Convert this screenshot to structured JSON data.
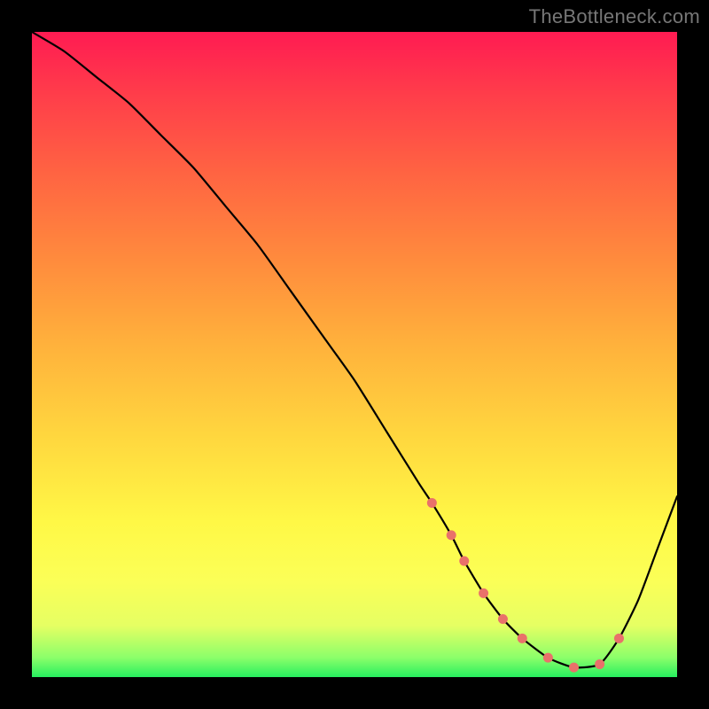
{
  "watermark": "TheBottleneck.com",
  "chart_data": {
    "type": "line",
    "title": "",
    "xlabel": "",
    "ylabel": "",
    "xlim": [
      0,
      100
    ],
    "ylim": [
      0,
      100
    ],
    "series": [
      {
        "name": "bottleneck-curve",
        "x": [
          0,
          5,
          10,
          15,
          20,
          25,
          30,
          35,
          40,
          45,
          50,
          55,
          60,
          62,
          65,
          67,
          70,
          73,
          76,
          80,
          84,
          88,
          91,
          94,
          97,
          100
        ],
        "values": [
          100,
          97,
          93,
          89,
          84,
          79,
          73,
          67,
          60,
          53,
          46,
          38,
          30,
          27,
          22,
          18,
          13,
          9,
          6,
          3,
          1.5,
          2,
          6,
          12,
          20,
          28
        ]
      }
    ],
    "dots": {
      "name": "highlighted-range",
      "x": [
        62,
        65,
        67,
        70,
        73,
        76,
        80,
        84,
        88,
        91
      ],
      "values": [
        27,
        22,
        18,
        13,
        9,
        6,
        3,
        1.5,
        2,
        6
      ]
    },
    "dot_color": "#e9716a",
    "curve_color": "#000000"
  }
}
